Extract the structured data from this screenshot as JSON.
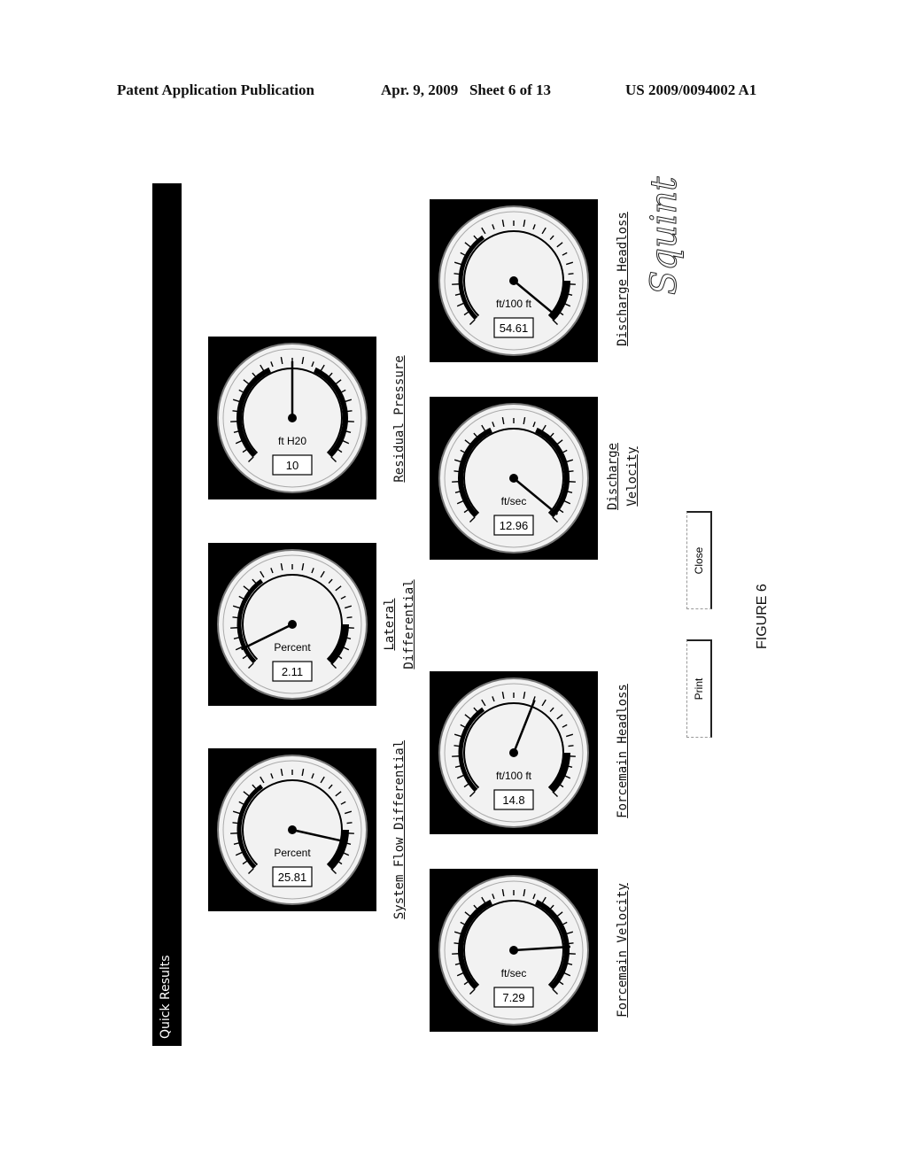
{
  "header": {
    "publication": "Patent Application Publication",
    "date_sheet": "Apr. 9, 2009   Sheet 6 of 13",
    "number": "US 2009/0094002 A1"
  },
  "window": {
    "title": "Quick Results"
  },
  "gauges": [
    {
      "label": "System Flow Differential",
      "unit": "Percent",
      "value": "25.81",
      "needle_fraction": 0.88,
      "style": "top-arc"
    },
    {
      "label": "Lateral Differential",
      "label_lines": [
        "Lateral",
        "Differential"
      ],
      "unit": "Percent",
      "value": "2.11",
      "needle_fraction": 0.07,
      "style": "top-arc"
    },
    {
      "label": "Residual Pressure",
      "unit": "ft H20",
      "value": "10",
      "needle_fraction": 0.5,
      "style": "split-arc"
    },
    {
      "label": "Forcemain Velocity",
      "unit": "ft/sec",
      "value": "7.29",
      "needle_fraction": 0.82,
      "style": "split-arc"
    },
    {
      "label": "Forcemain Headloss",
      "unit": "ft/100 ft",
      "value": "14.8",
      "needle_fraction": 0.58,
      "style": "top-arc"
    },
    {
      "label": "Discharge Velocity",
      "label_lines": [
        "Discharge",
        "Velocity"
      ],
      "unit": "ft/sec",
      "value": "12.96",
      "needle_fraction": 0.98,
      "style": "split-arc"
    },
    {
      "label": "Discharge Headloss",
      "unit": "ft/100 ft",
      "value": "54.61",
      "needle_fraction": 0.98,
      "style": "top-arc"
    }
  ],
  "buttons": {
    "print": "Print",
    "close": "Close"
  },
  "logo": "Squint",
  "figure_caption": "FIGURE 6"
}
